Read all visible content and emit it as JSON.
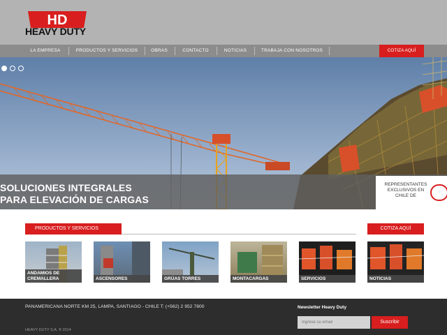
{
  "brand": {
    "badge": "HD",
    "name": "HEAVY DUTY"
  },
  "nav": {
    "items": [
      {
        "label": "LA EMPRESA"
      },
      {
        "label": "PRODUCTOS Y SERVICIOS"
      },
      {
        "label": "OBRAS"
      },
      {
        "label": "CONTACTO"
      },
      {
        "label": "NOTICIAS"
      },
      {
        "label": "TRABAJA CON NOSOTROS"
      }
    ],
    "cta": "COTIZA AQUÍ"
  },
  "hero": {
    "title_line1": "SOLUCIONES INTEGRALES",
    "title_line2": "PARA ELEVACIÓN DE CARGAS",
    "badge_text": "REPRESENTANTES EXCLUSIVOS EN CHILE DE",
    "slide_count": 3,
    "active_slide": 1
  },
  "sections": {
    "products_title": "PRODUCTOS Y SERVICIOS",
    "quote_title": "COTIZA AQUÍ"
  },
  "tiles": [
    {
      "label": "ANDAMIOS DE CREMALLERA"
    },
    {
      "label": "ASCENSORES"
    },
    {
      "label": "GRÚAS TORRES"
    },
    {
      "label": "MONTACARGAS"
    },
    {
      "label": "SERVICIOS"
    },
    {
      "label": "NOTICIAS"
    }
  ],
  "footer": {
    "address": "PANAMERICANA NORTE KM 25, LAMPA, SANTIAGO - CHILE T: (+562) 2 952 7800",
    "copyright": "HEAVY DUTY S.A. ® 2014",
    "newsletter_title": "Newsletter Heavy Duty",
    "email_placeholder": "Ingrese su email",
    "subscribe_label": "Suscribir"
  },
  "colors": {
    "accent": "#d81e1e",
    "header_bg": "#b3b3b3",
    "nav_bg": "#8c8c8c",
    "footer_bg": "#2d2d2d"
  }
}
